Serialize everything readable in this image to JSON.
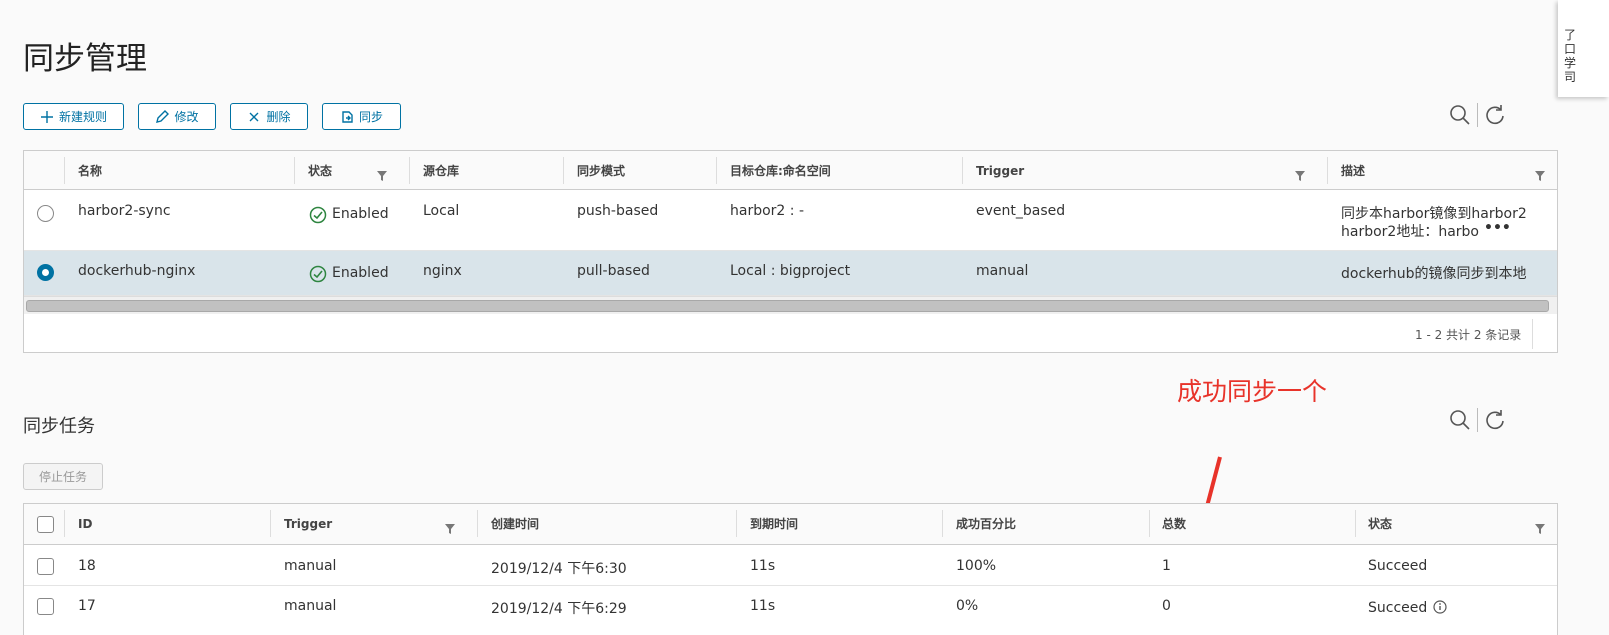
{
  "page": {
    "title": "同步管理"
  },
  "toolbar": {
    "new_label": "新建规则",
    "edit_label": "修改",
    "delete_label": "删除",
    "sync_label": "同步"
  },
  "rules_table": {
    "columns": [
      "名称",
      "状态",
      "源仓库",
      "同步模式",
      "目标仓库:命名空间",
      "Trigger",
      "描述"
    ],
    "rows": [
      {
        "name": "harbor2-sync",
        "status": "Enabled",
        "source": "Local",
        "mode": "push-based",
        "target": "harbor2 : -",
        "trigger": "event_based",
        "desc_line1": "同步本harbor镜像到harbor2",
        "desc_line2": "harbor2地址：harbo",
        "desc_more": "•••",
        "selected": false
      },
      {
        "name": "dockerhub-nginx",
        "status": "Enabled",
        "source": "nginx",
        "mode": "pull-based",
        "target": "Local : bigproject",
        "trigger": "manual",
        "desc_line1": "dockerhub的镜像同步到本地",
        "selected": true
      }
    ],
    "footer": "1 - 2 共计 2 条记录"
  },
  "tasks": {
    "title": "同步任务",
    "stop_label": "停止任务",
    "columns": [
      "ID",
      "Trigger",
      "创建时间",
      "到期时间",
      "成功百分比",
      "总数",
      "状态"
    ],
    "rows": [
      {
        "id": "18",
        "trigger": "manual",
        "created": "2019/12/4 下午6:30",
        "duration": "11s",
        "percent": "100%",
        "total": "1",
        "status": "Succeed"
      },
      {
        "id": "17",
        "trigger": "manual",
        "created": "2019/12/4 下午6:29",
        "duration": "11s",
        "percent": "0%",
        "total": "0",
        "status": "Succeed"
      }
    ]
  },
  "annotation": {
    "text": "成功同步一个",
    "color": "#e8332a"
  },
  "corner_panel": {
    "text": "了 口 学 司"
  },
  "colors": {
    "accent": "#0072a3",
    "success": "#2e8540",
    "selected_row": "#d9e4ea"
  },
  "icons": [
    "plus-icon",
    "pencil-icon",
    "x-icon",
    "sync-icon",
    "search-icon",
    "refresh-icon",
    "filter-icon",
    "check-circle-icon",
    "info-icon"
  ]
}
